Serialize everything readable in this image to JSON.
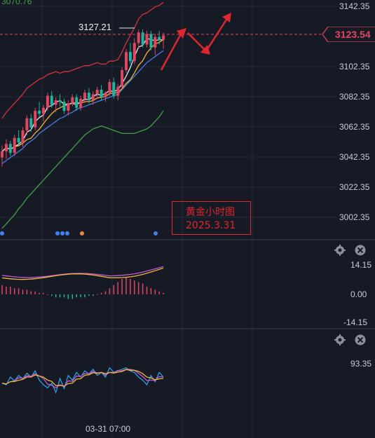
{
  "colors": {
    "background": "#161a25",
    "grid": "#262b38",
    "separator": "#3a3f4c",
    "candle_up": "#e2455f",
    "candle_down": "#22b39c",
    "ma_white": "#e8e8e8",
    "ma_yellow": "#f2b53a",
    "ma_blue": "#4a7de3",
    "ma_green": "#43a047",
    "bb_red": "#d8323d",
    "annotation": "#e0262e",
    "macd_purple": "#c25ad6",
    "osc_cyan": "#29a9f0"
  },
  "header": {
    "top_value": "3070.76"
  },
  "price_axis": {
    "ticks": [
      "3142.35",
      "3102.35",
      "3082.35",
      "3062.35",
      "3042.35",
      "3022.35",
      "3002.35"
    ]
  },
  "current_price": "3123.54",
  "high_marker": "3127.21",
  "annotation": {
    "line1": "黄金小时图",
    "line2": "2025.3.31"
  },
  "macd_axis": {
    "ticks": [
      "14.15",
      "0.00",
      "-14.15"
    ]
  },
  "osc_axis": {
    "ticks": [
      "93.35"
    ]
  },
  "time_axis": {
    "label": "03-31 07:00"
  },
  "icons": {
    "pane2_settings": "gear-icon",
    "pane2_close": "close-icon",
    "pane3_settings": "gear-icon",
    "pane3_close": "close-icon"
  },
  "chart_data": {
    "type": "candlestick",
    "ylim": [
      2991,
      3146
    ],
    "ohlc": [
      [
        3042,
        3050,
        3036,
        3046
      ],
      [
        3046,
        3054,
        3041,
        3051
      ],
      [
        3051,
        3053,
        3043,
        3045
      ],
      [
        3045,
        3057,
        3043,
        3055
      ],
      [
        3055,
        3060,
        3050,
        3052
      ],
      [
        3052,
        3062,
        3049,
        3060
      ],
      [
        3060,
        3070,
        3057,
        3068
      ],
      [
        3068,
        3071,
        3059,
        3062
      ],
      [
        3062,
        3075,
        3060,
        3073
      ],
      [
        3073,
        3079,
        3069,
        3071
      ],
      [
        3071,
        3077,
        3066,
        3075
      ],
      [
        3075,
        3085,
        3073,
        3083
      ],
      [
        3083,
        3086,
        3075,
        3077
      ],
      [
        3077,
        3082,
        3072,
        3080
      ],
      [
        3080,
        3084,
        3076,
        3079
      ],
      [
        3079,
        3081,
        3071,
        3073
      ],
      [
        3073,
        3080,
        3070,
        3078
      ],
      [
        3078,
        3084,
        3076,
        3082
      ],
      [
        3082,
        3084,
        3073,
        3075
      ],
      [
        3075,
        3083,
        3073,
        3081
      ],
      [
        3081,
        3087,
        3078,
        3085
      ],
      [
        3085,
        3088,
        3078,
        3080
      ],
      [
        3080,
        3086,
        3077,
        3084
      ],
      [
        3084,
        3089,
        3081,
        3087
      ],
      [
        3087,
        3090,
        3080,
        3082
      ],
      [
        3082,
        3086,
        3079,
        3085
      ],
      [
        3085,
        3094,
        3083,
        3092
      ],
      [
        3092,
        3095,
        3081,
        3083
      ],
      [
        3083,
        3091,
        3080,
        3089
      ],
      [
        3089,
        3102,
        3087,
        3100
      ],
      [
        3100,
        3114,
        3098,
        3112
      ],
      [
        3112,
        3118,
        3104,
        3106
      ],
      [
        3106,
        3121,
        3104,
        3118
      ],
      [
        3118,
        3127,
        3114,
        3125
      ],
      [
        3125,
        3127,
        3115,
        3117
      ],
      [
        3117,
        3126,
        3115,
        3124
      ],
      [
        3124,
        3126,
        3113,
        3115
      ],
      [
        3115,
        3124,
        3110,
        3122
      ],
      [
        3122,
        3126,
        3117,
        3120
      ],
      [
        3120,
        3125,
        3114,
        3123
      ]
    ],
    "bb_upper": [
      3068,
      3072,
      3075,
      3078,
      3081,
      3084,
      3088,
      3090,
      3092,
      3094,
      3095,
      3097,
      3098,
      3099,
      3098,
      3099,
      3099,
      3100,
      3101,
      3102,
      3103,
      3103,
      3104,
      3105,
      3104,
      3104,
      3106,
      3106,
      3107,
      3112,
      3118,
      3123,
      3128,
      3134,
      3137,
      3138,
      3140,
      3142,
      3143,
      3145
    ],
    "ma_blue": [
      3038,
      3040,
      3042,
      3044,
      3046,
      3048,
      3051,
      3053,
      3055,
      3058,
      3060,
      3062,
      3064,
      3066,
      3068,
      3069,
      3071,
      3072,
      3074,
      3075,
      3076,
      3077,
      3078,
      3079,
      3080,
      3081,
      3082,
      3083,
      3084,
      3087,
      3090,
      3093,
      3096,
      3099,
      3102,
      3105,
      3107,
      3109,
      3111,
      3113
    ],
    "ma_green": [
      2995,
      2998,
      3001,
      3004,
      3008,
      3011,
      3015,
      3018,
      3021,
      3024,
      3027,
      3030,
      3033,
      3036,
      3039,
      3042,
      3045,
      3048,
      3051,
      3054,
      3057,
      3059,
      3061,
      3062,
      3063,
      3062,
      3061,
      3060,
      3059,
      3058,
      3058,
      3058,
      3058,
      3059,
      3060,
      3061,
      3063,
      3066,
      3069,
      3073
    ],
    "macd_hist": [
      6,
      5,
      5,
      4,
      4,
      3,
      3,
      2,
      2,
      1,
      1,
      0,
      -1,
      -2,
      -2,
      -2,
      -3,
      -3,
      -2,
      -2,
      -2,
      -1,
      -1,
      0,
      1,
      2,
      4,
      6,
      8,
      10,
      11,
      10,
      9,
      8,
      7,
      5,
      4,
      3,
      2,
      1
    ],
    "osc_cyan": [
      72,
      70,
      80,
      75,
      82,
      78,
      85,
      80,
      88,
      76,
      70,
      66,
      72,
      60,
      78,
      65,
      82,
      76,
      86,
      80,
      88,
      84,
      90,
      82,
      86,
      80,
      92,
      86,
      88,
      90,
      92,
      88,
      86,
      80,
      76,
      70,
      82,
      74,
      86,
      80
    ]
  }
}
